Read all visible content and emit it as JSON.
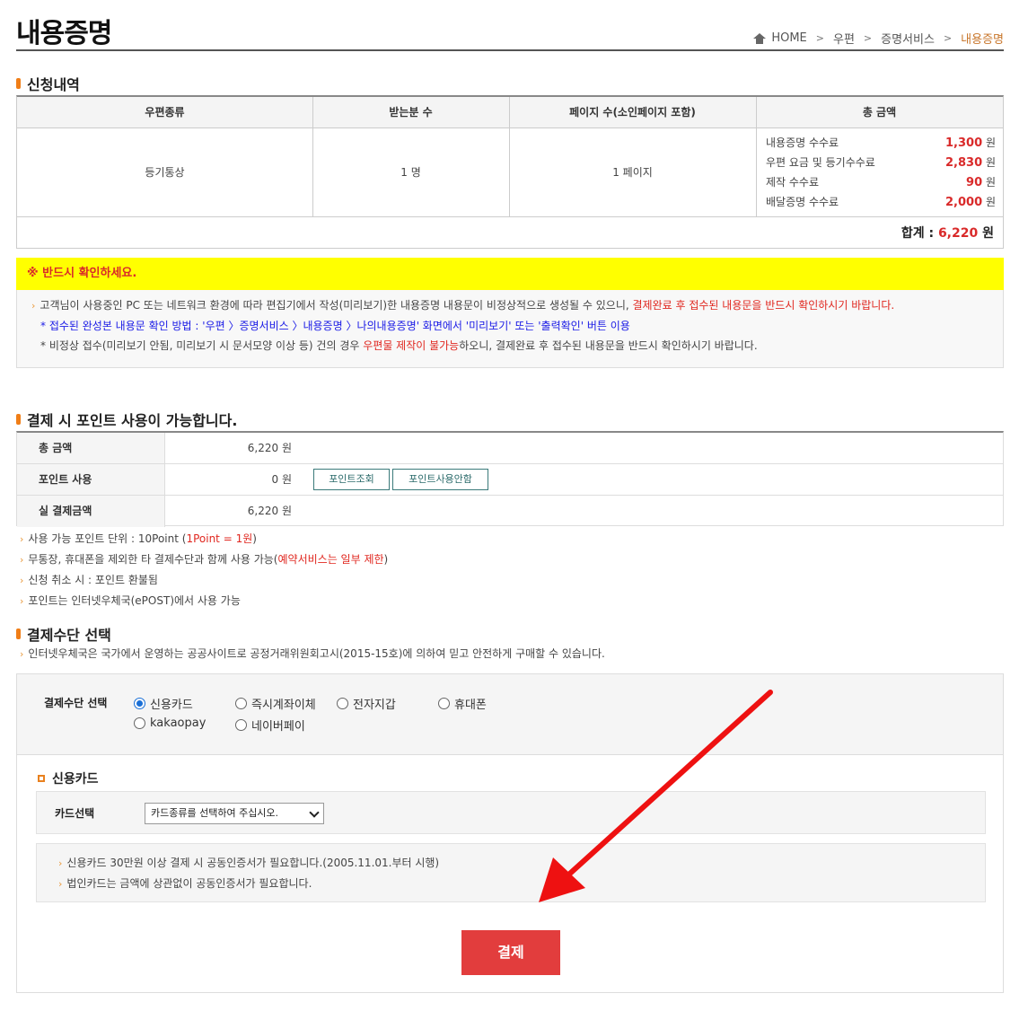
{
  "header": {
    "title": "내용증명",
    "breadcrumb": [
      "HOME",
      "우편",
      "증명서비스",
      "내용증명"
    ]
  },
  "application": {
    "section_title": "신청내역",
    "columns": [
      "우편종류",
      "받는분 수",
      "페이지 수(소인페이지 포함)",
      "총 금액"
    ],
    "mail_type": "등기통상",
    "recipients": "1 명",
    "pages": "1 페이지",
    "fees": [
      {
        "label": "내용증명 수수료",
        "amount": "1,300",
        "unit": "원"
      },
      {
        "label": "우편 요금 및 등기수수료",
        "amount": "2,830",
        "unit": "원"
      },
      {
        "label": "제작 수수료",
        "amount": "90",
        "unit": "원"
      },
      {
        "label": "배달증명 수수료",
        "amount": "2,000",
        "unit": "원"
      }
    ],
    "total_label": "합계 : ",
    "total_value": "6,220",
    "total_unit": " 원"
  },
  "notice": {
    "title": "※ 반드시 확인하세요.",
    "line1_a": "고객님이 사용중인 PC 또는 네트워크 환경에 따라 편집기에서 작성(미리보기)한 내용증명 내용문이 비정상적으로 생성될 수 있으니, ",
    "line1_b": "결제완료 후 접수된 내용문을 반드시 확인하시기 바랍니다.",
    "line2": "* 접수된 완성본 내용문 확인 방법 : '우편 〉증명서비스 〉내용증명 〉나의내용증명' 화면에서 '미리보기' 또는 '출력확인' 버튼 이용",
    "line3_a": "* 비정상 접수(미리보기 안됨, 미리보기 시 문서모양 이상 등) 건의 경우 ",
    "line3_b": "우편물 제작이 불가능",
    "line3_c": "하오니, 결제완료 후 접수된 내용문을 반드시 확인하시기 바랍니다."
  },
  "points": {
    "section_title": "결제 시 포인트 사용이 가능합니다.",
    "rows": [
      {
        "label": "총 금액",
        "value": "6,220 원"
      },
      {
        "label": "포인트 사용",
        "value": "0 원"
      },
      {
        "label": "실 결제금액",
        "value": "6,220 원"
      }
    ],
    "btn_lookup": "포인트조회",
    "btn_cancel": "포인트사용안함",
    "note1_a": "사용 가능 포인트 단위 : 10Point (",
    "note1_b": "1Point = 1원",
    "note1_c": ")",
    "note2_a": "무통장, 휴대폰을 제외한 타 결제수단과 함께 사용 가능(",
    "note2_b": "예약서비스는 일부 제한",
    "note2_c": ")",
    "note3": "신청 취소 시 : 포인트 환불됨",
    "note4": "포인트는 인터넷우체국(ePOST)에서 사용 가능"
  },
  "payment": {
    "section_title": "결제수단 선택",
    "desc": "인터넷우체국은 국가에서 운영하는 공공사이트로 공정거래위원회고시(2015-15호)에 의하여 믿고 안전하게 구매할 수 있습니다.",
    "method_label": "결제수단 선택",
    "methods": [
      {
        "label": "신용카드",
        "selected": true
      },
      {
        "label": "즉시계좌이체",
        "selected": false
      },
      {
        "label": "전자지갑",
        "selected": false
      },
      {
        "label": "휴대폰",
        "selected": false
      },
      {
        "label": "kakaopay",
        "selected": false
      },
      {
        "label": "네이버페이",
        "selected": false
      }
    ],
    "card_section_title": "신용카드",
    "card_select_label": "카드선택",
    "card_select_value": "카드종류를 선택하여 주십시오.",
    "card_note1": "신용카드 30만원 이상 결제 시 공동인증서가 필요합니다.(2005.11.01.부터 시행)",
    "card_note2": "법인카드는 금액에 상관없이 공동인증서가 필요합니다.",
    "pay_button": "결제"
  },
  "colors": {
    "accent_orange": "#f07e17",
    "price_red": "#d92a2a",
    "notice_yellow": "#ffff00",
    "pay_button": "#e23d3d",
    "arrow_red": "#ee1111"
  }
}
